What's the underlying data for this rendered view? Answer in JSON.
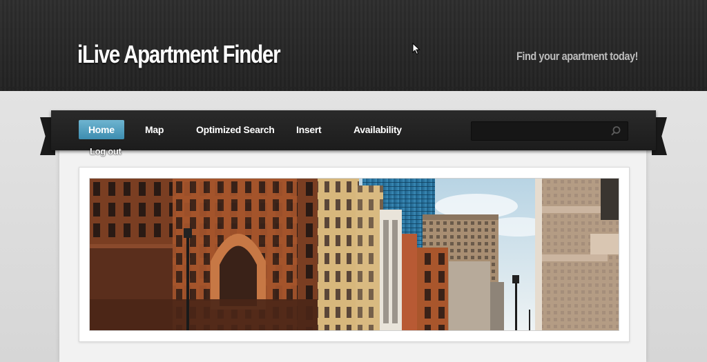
{
  "header": {
    "title": "iLive Apartment Finder",
    "tagline": "Find your apartment today!"
  },
  "nav": {
    "items": [
      {
        "label": "Home",
        "active": true
      },
      {
        "label": "Map",
        "active": false
      },
      {
        "label": "Optimized Search",
        "active": false
      },
      {
        "label": "Insert",
        "active": false
      },
      {
        "label": "Availability",
        "active": false
      }
    ],
    "logout_label": "Log out",
    "search_placeholder": ""
  },
  "colors": {
    "header_bg": "#262626",
    "nav_bg": "#1f1f1f",
    "active_tab": "#4a9ec0",
    "page_bg": "#dcdcdc"
  },
  "banner": {
    "icon": "city-street-photo"
  }
}
